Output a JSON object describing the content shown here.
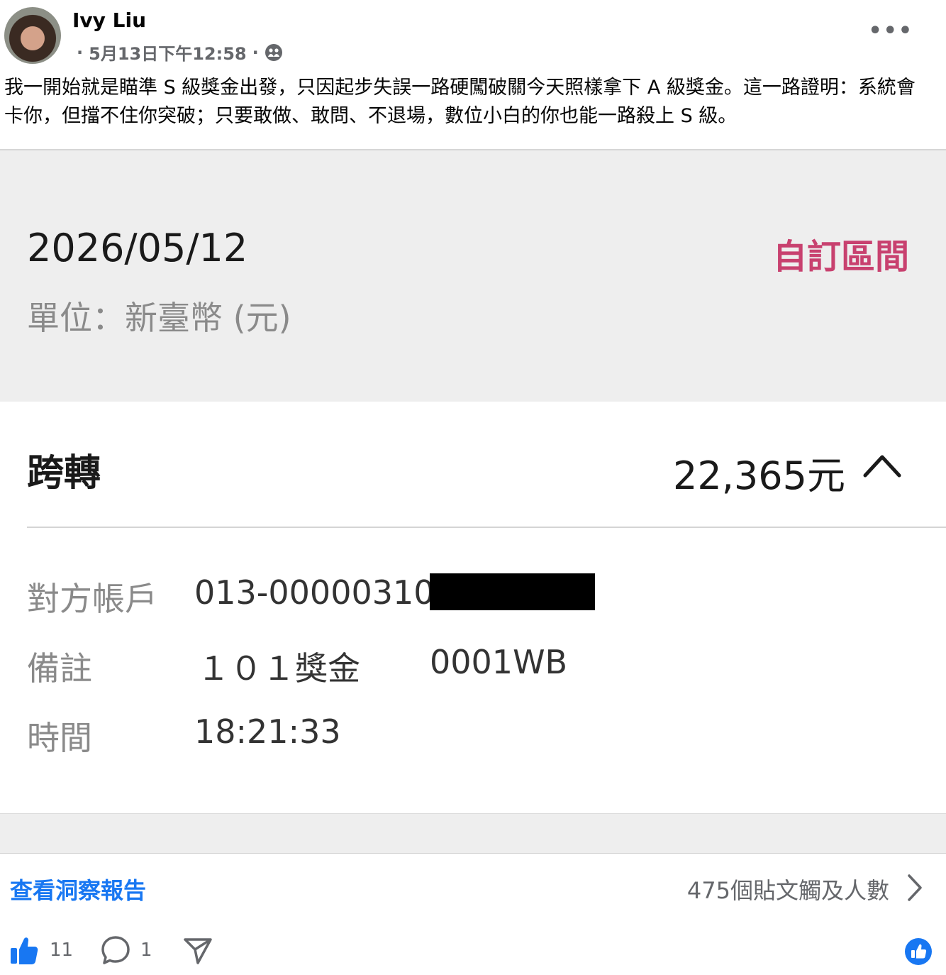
{
  "post": {
    "author": "Ivy Liu",
    "timestamp": "5月13日下午12:58",
    "separator": "·",
    "more_label": "•••",
    "caption": "我一開始就是瞄準 S 級獎金出發，只因起步失誤一路硬闖破關今天照樣拿下 A 級獎金。這一路證明：系統會卡你，但擋不住你突破；只要敢做、敢問、不退場，數位小白的你也能一路殺上 S 級。"
  },
  "receipt": {
    "date": "2026/05/12",
    "custom_range": "自訂區間",
    "unit": "單位：新臺幣 (元)",
    "type": "跨轉",
    "amount": "22,365元",
    "rows": [
      {
        "label": "對方帳戶",
        "value": "013-00000310"
      },
      {
        "label": "備註",
        "value": "１０１獎金",
        "value2": "0001WB"
      },
      {
        "label": "時間",
        "value": "18:21:33"
      }
    ]
  },
  "insights": {
    "link": "查看洞察報告",
    "reach": "475個貼文觸及人數"
  },
  "actions": {
    "likes": "11",
    "comments": "1"
  },
  "colors": {
    "link_blue": "#1877f2",
    "accent_pink": "#c8416f",
    "secondary_text": "#65676b"
  }
}
